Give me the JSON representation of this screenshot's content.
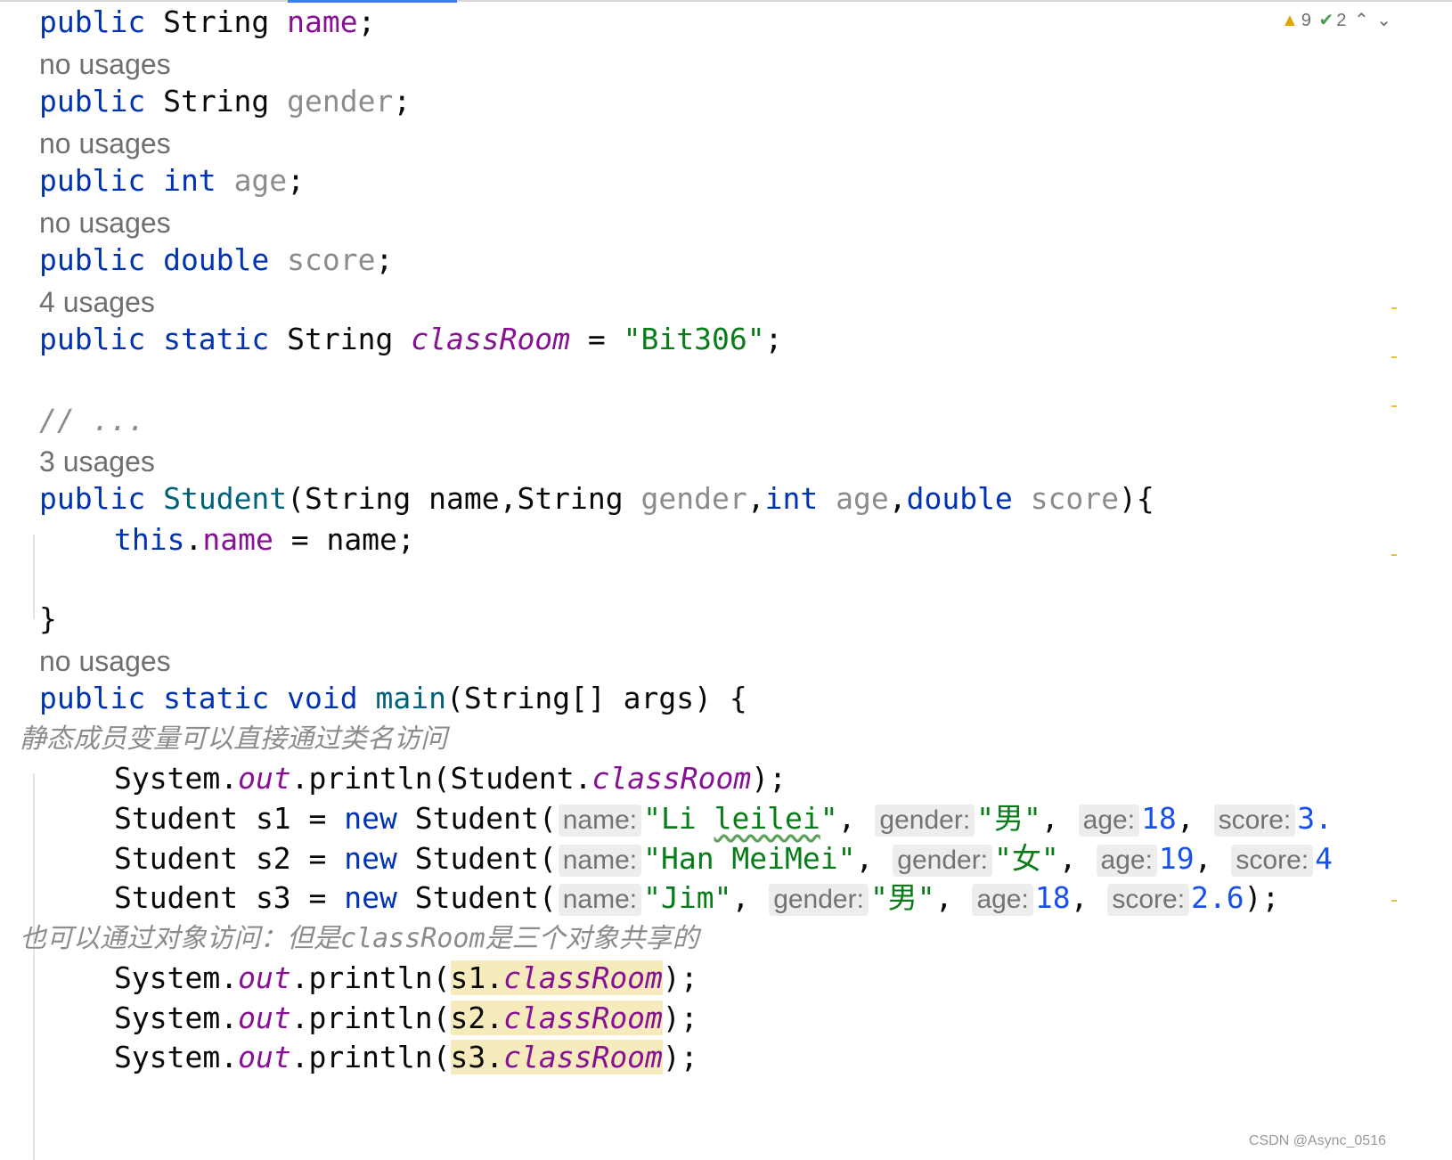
{
  "status": {
    "warning_icon": "warning-triangle-icon",
    "warnings": "9",
    "check_icon": "double-check-icon",
    "weak_warnings": "2",
    "prev_icon": "chevron-up-icon",
    "next_icon": "chevron-down-icon"
  },
  "code": {
    "l1": {
      "kw": "public",
      "type": " String ",
      "field": "name",
      "end": ";"
    },
    "u1": "no usages",
    "l2": {
      "kw": "public",
      "type": " String ",
      "field": "gender",
      "end": ";"
    },
    "u2": "no usages",
    "l3": {
      "kw": "public int",
      "sp": " ",
      "field": "age",
      "end": ";"
    },
    "u3": "no usages",
    "l4": {
      "kw": "public double",
      "sp": " ",
      "field": "score",
      "end": ";"
    },
    "u4": "4 usages",
    "l5": {
      "kw": "public static",
      "type": " String ",
      "field": "classRoom",
      "op": " = ",
      "str": "\"Bit306\"",
      "end": ";"
    },
    "l6": "// ...",
    "u6": "3 usages",
    "l7": {
      "kw": "public",
      "sp": " ",
      "fn": "Student",
      "p1": "(String name,String ",
      "g": "gender",
      "c1": ",",
      "kint": "int",
      "sp2": " ",
      "a": "age",
      "c2": ",",
      "kdbl": "double",
      "sp3": " ",
      "s": "score",
      "end": "){"
    },
    "l8": {
      "kw": "this",
      "dot": ".",
      "field": "name",
      "rest": " = name;"
    },
    "l9": "}",
    "u9": "no usages",
    "l10": {
      "kw": "public static void",
      "sp": " ",
      "fn": "main",
      "rest": "(String[] args) {"
    },
    "c1": "静态成员变量可以直接通过类名访问",
    "l11": {
      "pre": "System.",
      "out": "out",
      "mid": ".println(Student.",
      "field": "classRoom",
      "end": ");"
    },
    "s1": {
      "pre": "Student s1 = ",
      "kw": "new",
      "mid": " Student(",
      "h_name": "name:",
      "v_name": "\"Li ",
      "v_name2": "leilei",
      "v_name3": "\"",
      "comma1": ", ",
      "h_gender": "gender:",
      "v_gender": "\"男\"",
      "comma2": ", ",
      "h_age": "age:",
      "v_age": "18",
      "comma3": ", ",
      "h_score": "score:",
      "v_score": "3."
    },
    "s2": {
      "pre": "Student s2 = ",
      "kw": "new",
      "mid": " Student(",
      "h_name": "name:",
      "v_name": "\"Han MeiMei\"",
      "comma1": ", ",
      "h_gender": "gender:",
      "v_gender": "\"女\"",
      "comma2": ", ",
      "h_age": "age:",
      "v_age": "19",
      "comma3": ", ",
      "h_score": "score:",
      "v_score": "4"
    },
    "s3": {
      "pre": "Student s3 = ",
      "kw": "new",
      "mid": " Student(",
      "h_name": "name:",
      "v_name": "\"Jim\"",
      "comma1": ", ",
      "h_gender": "gender:",
      "v_gender": "\"男\"",
      "comma2": ", ",
      "h_age": "age:",
      "v_age": "18",
      "comma3": ", ",
      "h_score": "score:",
      "v_score": "2.6",
      "end": ");"
    },
    "c2": {
      "a": "也可以通过对象访问：但是",
      "b": "classRoom",
      "c": "是三个对象共享的"
    },
    "p1": {
      "pre": "System.",
      "out": "out",
      "mid": ".println(",
      "obj": "s1.",
      "field": "classRoom",
      "end": ");"
    },
    "p2": {
      "pre": "System.",
      "out": "out",
      "mid": ".println(",
      "obj": "s2.",
      "field": "classRoom",
      "end": ");"
    },
    "p3": {
      "pre": "System.",
      "out": "out",
      "mid": ".println(",
      "obj": "s3.",
      "field": "classRoom",
      "end": ");"
    }
  },
  "watermark": "CSDN @Async_0516"
}
